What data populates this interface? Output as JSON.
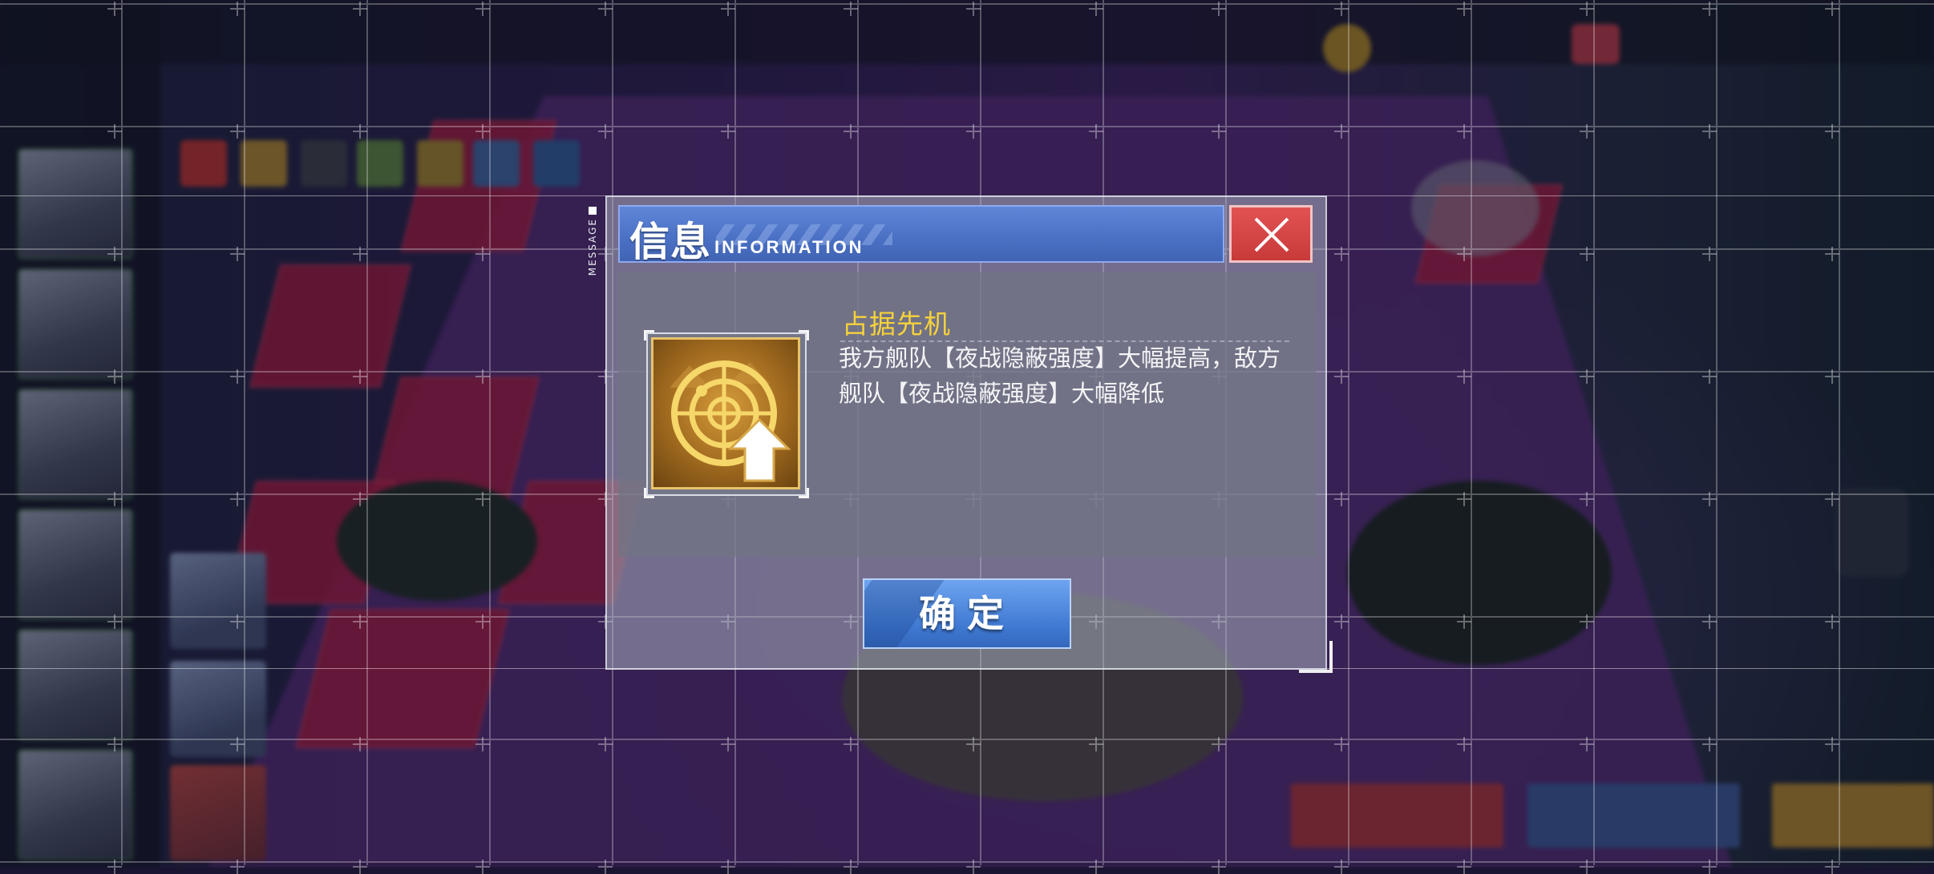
{
  "dialog": {
    "title": "信息",
    "title_en": "INFORMATION",
    "side_tag": "MESSAGE",
    "close_icon": "close-icon",
    "item_icon": "radar-up-icon",
    "effect_name": "占据先机",
    "effect_description": "我方舰队【夜战隐蔽强度】大幅提高，敌方舰队【夜战隐蔽强度】大幅降低",
    "confirm_label": "确定"
  },
  "colors": {
    "title_bar": "#4a70c4",
    "close_button": "#d84545",
    "effect_name": "#f6d23a",
    "confirm_button": "#4a86dc"
  }
}
